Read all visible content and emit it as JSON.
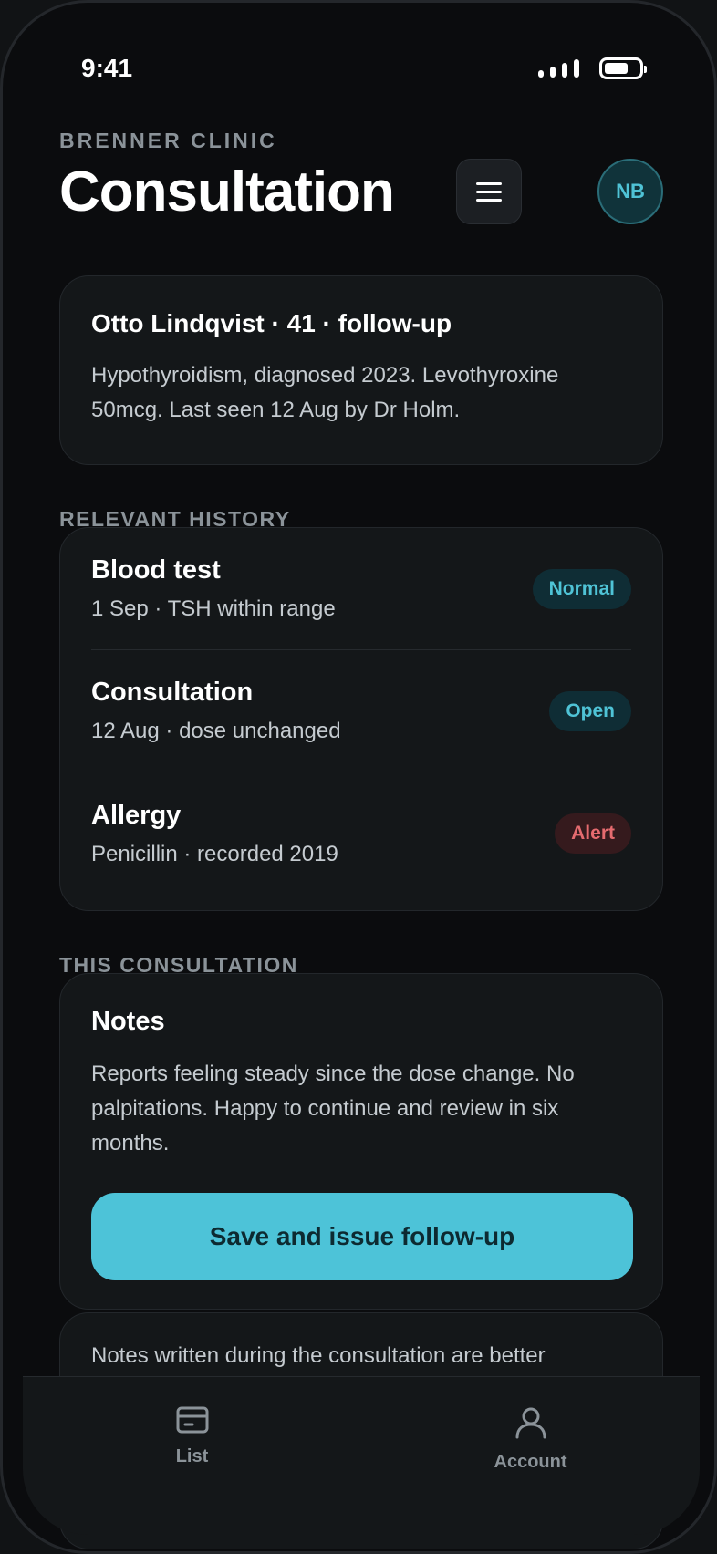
{
  "status": {
    "time": "9:41"
  },
  "header": {
    "clinic": "BRENNER CLINIC",
    "title": "Consultation",
    "avatar_initials": "NB"
  },
  "patient": {
    "name": "Otto Lindqvist · 41 · follow-up",
    "summary": "Hypothyroidism, diagnosed 2023. Levothyroxine 50mcg. Last seen 12 Aug by Dr Holm."
  },
  "history": {
    "label": "RELEVANT HISTORY",
    "items": [
      {
        "title": "Blood test",
        "sub": "1 Sep · TSH within range",
        "badge": "Normal",
        "badge_color": "#4fc3d6"
      },
      {
        "title": "Consultation",
        "sub": "12 Aug · dose unchanged",
        "badge": "Open",
        "badge_color": "#4fc3d6"
      },
      {
        "title": "Allergy",
        "sub": "Penicillin · recorded 2019",
        "badge": "Alert",
        "badge_color": "#e56b6f"
      }
    ]
  },
  "consultation": {
    "label": "THIS CONSULTATION",
    "notes_title": "Notes",
    "notes_text": "Reports feeling steady since the dose change. No palpitations. Happy to continue and review in six months.",
    "primary_button": "Save and issue follow-up"
  },
  "tip": {
    "text": "Notes written during the consultation are better"
  },
  "nav": {
    "items": [
      {
        "label": "List",
        "icon": "card-icon"
      },
      {
        "label": "Account",
        "icon": "person-icon"
      }
    ]
  },
  "colors": {
    "accent": "#4dc3d8",
    "alert": "#e56b6f",
    "background": "#0b0c0e",
    "card": "#141719"
  }
}
